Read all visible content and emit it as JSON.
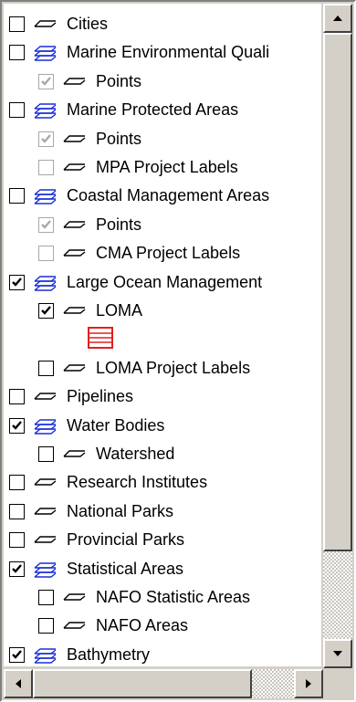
{
  "layers": [
    {
      "label": "Cities",
      "level": 0,
      "checked": false,
      "enabled": true,
      "icon": "line-layer-icon"
    },
    {
      "label": "Marine Environmental Quali",
      "level": 0,
      "checked": false,
      "enabled": true,
      "icon": "group-layer-icon"
    },
    {
      "label": "Points",
      "level": 1,
      "checked": true,
      "enabled": false,
      "icon": "line-layer-icon"
    },
    {
      "label": "Marine Protected Areas",
      "level": 0,
      "checked": false,
      "enabled": true,
      "icon": "group-layer-icon"
    },
    {
      "label": "Points",
      "level": 1,
      "checked": true,
      "enabled": false,
      "icon": "line-layer-icon"
    },
    {
      "label": "MPA Project Labels",
      "level": 1,
      "checked": false,
      "enabled": false,
      "icon": "line-layer-icon"
    },
    {
      "label": "Coastal Management Areas",
      "level": 0,
      "checked": false,
      "enabled": true,
      "icon": "group-layer-icon"
    },
    {
      "label": "Points",
      "level": 1,
      "checked": true,
      "enabled": false,
      "icon": "line-layer-icon"
    },
    {
      "label": "CMA Project Labels",
      "level": 1,
      "checked": false,
      "enabled": false,
      "icon": "line-layer-icon"
    },
    {
      "label": "Large Ocean Management",
      "level": 0,
      "checked": true,
      "enabled": true,
      "icon": "group-layer-icon"
    },
    {
      "label": "LOMA",
      "level": 1,
      "checked": true,
      "enabled": true,
      "icon": "line-layer-icon"
    },
    {
      "label": "",
      "level": 1,
      "legend": true,
      "legend_color": "#e02020"
    },
    {
      "label": "LOMA Project Labels",
      "level": 1,
      "checked": false,
      "enabled": true,
      "icon": "line-layer-icon"
    },
    {
      "label": "Pipelines",
      "level": 0,
      "checked": false,
      "enabled": true,
      "icon": "line-layer-icon"
    },
    {
      "label": "Water Bodies",
      "level": 0,
      "checked": true,
      "enabled": true,
      "icon": "group-layer-icon"
    },
    {
      "label": "Watershed",
      "level": 1,
      "checked": false,
      "enabled": true,
      "icon": "line-layer-icon"
    },
    {
      "label": "Research Institutes",
      "level": 0,
      "checked": false,
      "enabled": true,
      "icon": "line-layer-icon"
    },
    {
      "label": "National Parks",
      "level": 0,
      "checked": false,
      "enabled": true,
      "icon": "line-layer-icon"
    },
    {
      "label": "Provincial Parks",
      "level": 0,
      "checked": false,
      "enabled": true,
      "icon": "line-layer-icon"
    },
    {
      "label": "Statistical Areas",
      "level": 0,
      "checked": true,
      "enabled": true,
      "icon": "group-layer-icon"
    },
    {
      "label": "NAFO Statistic Areas",
      "level": 1,
      "checked": false,
      "enabled": true,
      "icon": "line-layer-icon"
    },
    {
      "label": "NAFO Areas",
      "level": 1,
      "checked": false,
      "enabled": true,
      "icon": "line-layer-icon"
    },
    {
      "label": "Bathymetry",
      "level": 0,
      "checked": true,
      "enabled": true,
      "icon": "group-layer-icon"
    }
  ],
  "colors": {
    "background": "#d4d0c8",
    "list_background": "#ffffff",
    "group_icon": "#1a2fd8",
    "disabled_check": "#a8a8a8"
  },
  "scrollbars": {
    "up_icon": "arrow-up-icon",
    "down_icon": "arrow-down-icon",
    "left_icon": "arrow-left-icon",
    "right_icon": "arrow-right-icon"
  }
}
